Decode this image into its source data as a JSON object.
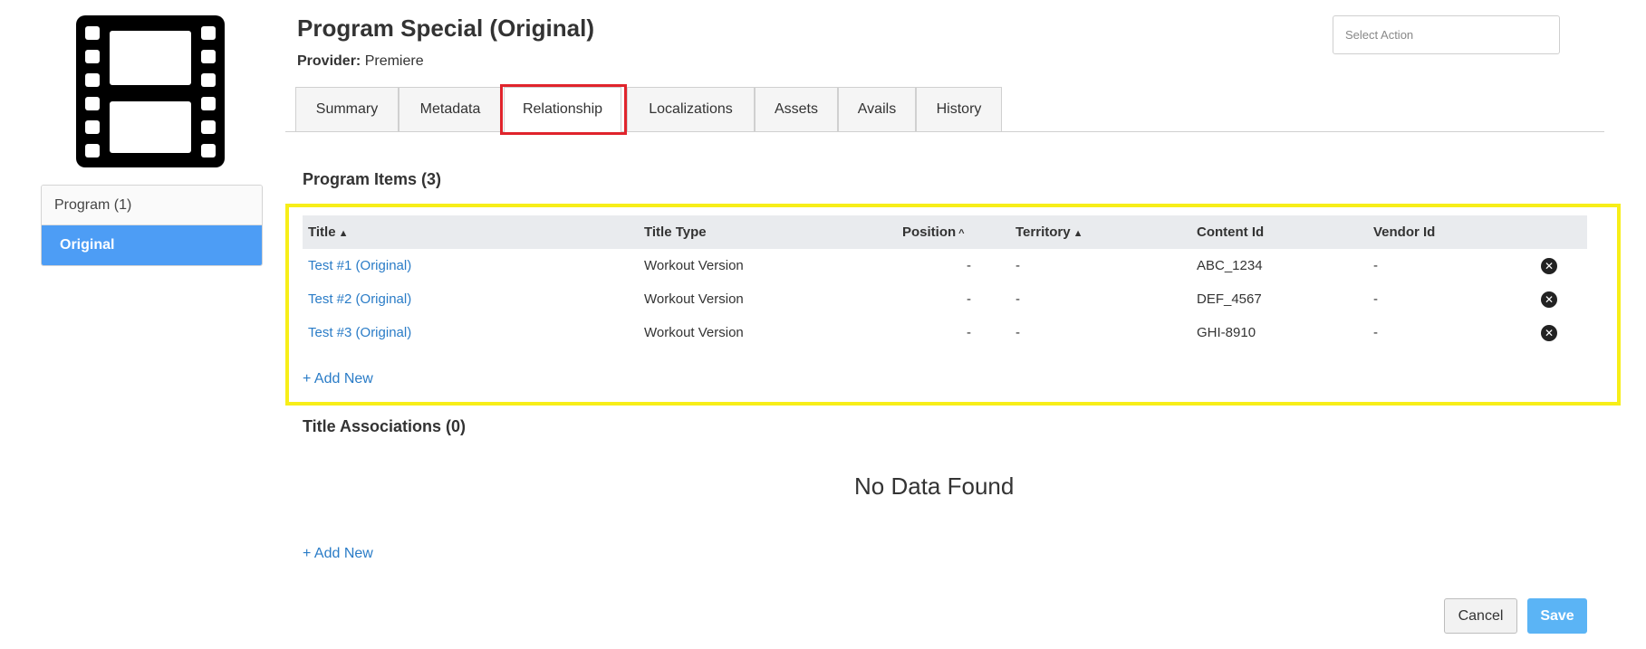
{
  "header": {
    "title": "Program Special (Original)",
    "provider_label": "Provider:",
    "provider_value": "Premiere",
    "select_action_placeholder": "Select Action"
  },
  "sidebar": {
    "header": "Program (1)",
    "items": [
      {
        "label": "Original",
        "active": true
      }
    ]
  },
  "tabs": [
    {
      "label": "Summary"
    },
    {
      "label": "Metadata"
    },
    {
      "label": "Relationship",
      "active": true
    },
    {
      "label": "Localizations"
    },
    {
      "label": "Assets"
    },
    {
      "label": "Avails"
    },
    {
      "label": "History"
    }
  ],
  "program_items": {
    "title": "Program Items (3)",
    "columns": {
      "title": "Title",
      "title_type": "Title Type",
      "position": "Position",
      "territory": "Territory",
      "content_id": "Content Id",
      "vendor_id": "Vendor Id"
    },
    "rows": [
      {
        "title": "Test #1 (Original)",
        "title_type": "Workout Version",
        "position": "-",
        "territory": "-",
        "content_id": "ABC_1234",
        "vendor_id": "-"
      },
      {
        "title": "Test #2 (Original)",
        "title_type": "Workout Version",
        "position": "-",
        "territory": "-",
        "content_id": "DEF_4567",
        "vendor_id": "-"
      },
      {
        "title": "Test #3 (Original)",
        "title_type": "Workout Version",
        "position": "-",
        "territory": "-",
        "content_id": "GHI-8910",
        "vendor_id": "-"
      }
    ],
    "add_new": "+ Add New"
  },
  "title_associations": {
    "title": "Title Associations (0)",
    "empty_message": "No Data Found",
    "add_new": "+ Add New"
  },
  "footer": {
    "cancel": "Cancel",
    "save": "Save"
  },
  "icons": {
    "media": "film-strip-icon",
    "sort_both": "sort-icon",
    "sort_asc": "sort-asc-icon",
    "remove": "remove-circle-icon"
  },
  "colors": {
    "accent": "#4d9df5",
    "link": "#2a7cc7",
    "save_button": "#5bb4f5",
    "highlight_red": "#e0242c",
    "highlight_yellow": "#f7ee18"
  }
}
